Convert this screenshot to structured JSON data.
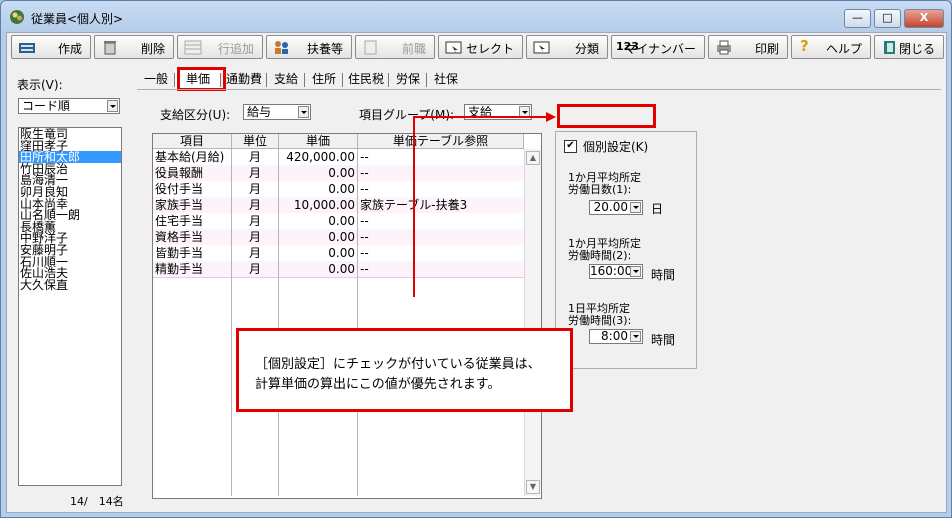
{
  "window": {
    "title": "従業員<個人別>",
    "min": "—",
    "max": "□",
    "close": "X"
  },
  "toolbar": {
    "create": "作成",
    "delete": "削除",
    "add_row": "行追加",
    "dependents": "扶養等",
    "previous_job": "前職",
    "select": "セレクト",
    "classify": "分類",
    "mynumber": "マイナンバー",
    "print": "印刷",
    "help": "ヘルプ",
    "close": "閉じる",
    "mynumber_icon_text": "123"
  },
  "left": {
    "display_label": "表示(V):",
    "display_value": "コード順",
    "employees": [
      "阪生竜司",
      "窪田孝子",
      "田所和太郎",
      "竹田辰治",
      "島海清一",
      "卯月良知",
      "山本尚幸",
      "山名順一朗",
      "長橋薫",
      "中野洋子",
      "安藤明子",
      "石川順一",
      "佐山浩夫",
      "大久保直"
    ],
    "selected_index": 2,
    "count": "14/　14名"
  },
  "tabs": [
    "一般",
    "単価",
    "通勤費",
    "支給",
    "住所",
    "住民税",
    "労保",
    "社保"
  ],
  "active_tab": 1,
  "form": {
    "pay_type_label": "支給区分(U):",
    "pay_type_value": "給与",
    "group_label": "項目グループ(M):",
    "group_value": "支給"
  },
  "grid": {
    "headers": [
      "項目",
      "単位",
      "単価",
      "単価テーブル参照"
    ],
    "rows": [
      {
        "item": "基本給(月給)",
        "unit": "月",
        "price": "420,000.00",
        "ref": "--"
      },
      {
        "item": "役員報酬",
        "unit": "月",
        "price": "0.00",
        "ref": "--"
      },
      {
        "item": "役付手当",
        "unit": "月",
        "price": "0.00",
        "ref": "--"
      },
      {
        "item": "家族手当",
        "unit": "月",
        "price": "10,000.00",
        "ref": "家族テーブル-扶養3"
      },
      {
        "item": "住宅手当",
        "unit": "月",
        "price": "0.00",
        "ref": "--"
      },
      {
        "item": "資格手当",
        "unit": "月",
        "price": "0.00",
        "ref": "--"
      },
      {
        "item": "皆勤手当",
        "unit": "月",
        "price": "0.00",
        "ref": "--"
      },
      {
        "item": "精勤手当",
        "unit": "月",
        "price": "0.00",
        "ref": "--"
      }
    ]
  },
  "settings": {
    "individual_label": "個別設定(K)",
    "individual_checked": true,
    "days_label1": "1か月平均所定",
    "days_label2": "労働日数(1):",
    "days_value": "20.00",
    "days_unit": "日",
    "hours_label1": "1か月平均所定",
    "hours_label2": "労働時間(2):",
    "hours_value": "160:00",
    "hours_unit": "時間",
    "daily_label1": "1日平均所定",
    "daily_label2": "労働時間(3):",
    "daily_value": "8:00",
    "daily_unit": "時間"
  },
  "callout": {
    "line1": "［個別設定］にチェックが付いている従業員は、",
    "line2": "計算単価の算出にこの値が優先されます。"
  },
  "colors": {
    "annotation_red": "#e00000",
    "selection_blue": "#3399ff"
  }
}
